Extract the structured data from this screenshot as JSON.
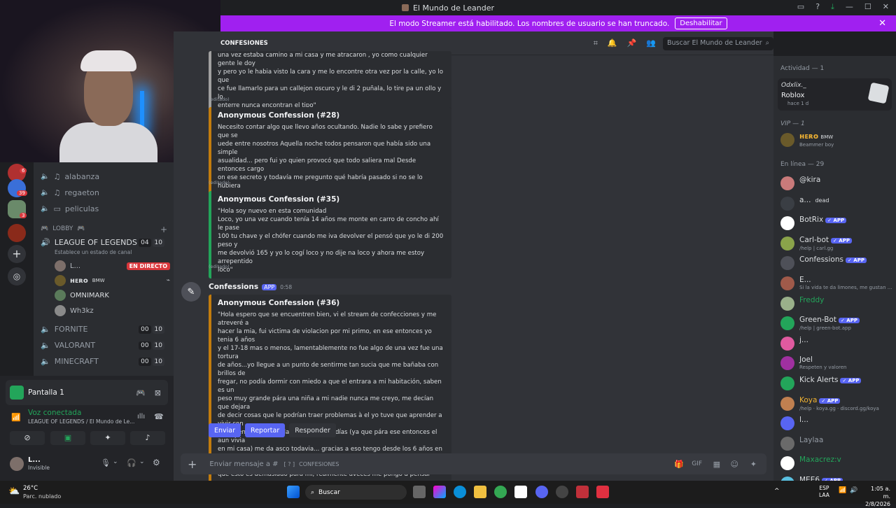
{
  "window": {
    "title": "El Mundo de Leander"
  },
  "streamer_banner": {
    "text": "El modo Streamer está habilitado. Los nombres de usuario se han truncado.",
    "button": "Deshabilitar"
  },
  "channel_header": {
    "name": "CONFESIONES",
    "search_placeholder": "Buscar El Mundo de Leander"
  },
  "sidebar": {
    "text_channels": [
      "alabanza",
      "regaeton",
      "peliculas"
    ],
    "category": "LOBBY",
    "voice_channels": [
      {
        "name": "LEAGUE OF LEGENDS",
        "status": "Establece un estado de canal",
        "count": "04",
        "limit": "10"
      },
      {
        "name": "FORNITE",
        "count": "00",
        "limit": "10"
      },
      {
        "name": "VALORANT",
        "count": "00",
        "limit": "10"
      },
      {
        "name": "MINECRAFT",
        "count": "00",
        "limit": "10"
      }
    ],
    "voice_users": [
      {
        "name": "L...",
        "tag": "EN DIRECTO"
      },
      {
        "name": "ʜᴇʀᴏ",
        "tag": "BMW"
      },
      {
        "name": "OMNIMARK",
        "tag": ""
      },
      {
        "name": "Wh3kz",
        "tag": ""
      }
    ],
    "guild_badges": [
      "6",
      "39",
      "3"
    ]
  },
  "panel": {
    "stream_title": "Pantalla 1",
    "voice_status": "Voz conectada",
    "voice_location": "LEAGUE OF LEGENDS / El Mundo de Le...",
    "user_name": "L...",
    "user_status": "Invisible"
  },
  "messages": {
    "top_embed_text": "una vez estaba camino a mi casa y me atracaron , yo como cualquier gente le doy\ny pero yo le habia visto la cara y me lo encontre otra vez por la calle, yo lo que\nce fue llamarlo para un callejon oscuro y le di 2 puñala, lo tire pa un ollo y lo\nenterre nunca encontran el tipo\"",
    "edited_label": "(editado)",
    "confessions": [
      {
        "title": "Anonymous Confession (#28)",
        "text": "Necesito contar algo que llevo años ocultando. Nadie lo sabe y prefiero que se\nuede entre nosotros Aquella noche todos pensaron que había sido una simple\nasualidad... pero fui yo quien provocó que todo saliera mal Desde entonces cargo\non ese secreto y todavía me pregunto qué habría pasado si no se lo hubiera\nmetido a la hija del teniente\""
      },
      {
        "title": "Anonymous Confession (#35)",
        "text": "\"Hola soy nuevo en esta comunidad\nLoco, yo una vez cuando tenía 14 años me monte en carro de concho ahí le pase\n100 tu chave y el chófer cuando me iva devolver el pensó que yo le di 200 peso y\nme devolvió 165 y yo lo cogí loco y no dije na loco y ahora me estoy arrepentido\nloco\""
      },
      {
        "title": "Anonymous Confession (#36)",
        "text": "\"Hola espero que se encuentren bien, vi el stream de confecciones y me atreveré a\nhacer la mia, fui victima de violacion por mi primo, en ese entonces yo tenia 6 años\ny el 17-18 mas o menos, lamentablemente no fue algo de una vez fue una tortura\nde años...yo llegue a un punto de sentirme tan sucia que me bañaba con brillos de\nfregar, no podía dormir con miedo a que el entrara a mi habitación, saben es un\npeso muy grande pára una niña a mi nadie nunca me creyo, me decían que dejara\nde decir cosas que le podrían traer problemas à el yo tuve que aprender a vivir con\neso a tener que verle la cara todos los días (ya que pára ese entonces el aun vivia\nen mi casa) me da asco todavia... gracias a eso tengo desde los 6 años en\ndepresión, aun no lo supero, me he intentalo suicidar muchas veces ya que siento\nque esto es demasiado pára mi, realmente aveces me pongo a pensar como\nalguien puede ser tan asqueroso pára hacerle algo a una NIÑA.\""
      }
    ],
    "bot_name": "Confessions",
    "bot_tag": "APP",
    "bot_time": "0:58",
    "buttons": {
      "send": "Enviar",
      "report": "Reportar",
      "reply": "Responder"
    }
  },
  "composer": {
    "placeholder": "Enviar mensaje a #",
    "channel": "CONFESIONES"
  },
  "members": {
    "activity_header": "Actividad — 1",
    "activity": {
      "name": "Odxlix._",
      "game": "Roblox",
      "time": "hace 1 d"
    },
    "vip_header": "VIP — 1",
    "vip": {
      "name": "ʜᴇʀᴏ",
      "tag": "BMW",
      "status": "Beammer boy"
    },
    "online_header": "En línea — 29",
    "online": [
      {
        "name": "@kira",
        "status": "",
        "app": false,
        "color": "#dbdee1"
      },
      {
        "name": "a...",
        "status": "",
        "app": false,
        "color": "#dbdee1",
        "inline": "dead"
      },
      {
        "name": "BotRix",
        "status": "",
        "app": true,
        "color": "#dbdee1"
      },
      {
        "name": "Carl-bot",
        "status": "/help | carl.gg",
        "app": true,
        "color": "#dbdee1"
      },
      {
        "name": "Confessions",
        "status": "",
        "app": true,
        "color": "#dbdee1"
      },
      {
        "name": "E...",
        "status": "Si la vida te da limones, me gustan ...",
        "app": false,
        "color": "#dbdee1"
      },
      {
        "name": "Freddy",
        "status": "",
        "app": false,
        "color": "#23a55a"
      },
      {
        "name": "Green-Bot",
        "status": "/help | green-bot.app",
        "app": true,
        "color": "#dbdee1"
      },
      {
        "name": "j...",
        "status": "",
        "app": false,
        "color": "#dbdee1"
      },
      {
        "name": "Joel",
        "status": "Respeten y valoren",
        "app": false,
        "color": "#dbdee1"
      },
      {
        "name": "Kick Alerts",
        "status": "",
        "app": true,
        "color": "#dbdee1"
      },
      {
        "name": "Koya",
        "status": "/help · koya.gg · discord.gg/koya",
        "app": true,
        "color": "#f0b232"
      },
      {
        "name": "l...",
        "status": "",
        "app": false,
        "color": "#dbdee1"
      },
      {
        "name": "Laylaa",
        "status": "",
        "app": false,
        "color": "#949ba4"
      },
      {
        "name": "Maxacrez:v",
        "status": "",
        "app": false,
        "color": "#23a55a"
      },
      {
        "name": "MEE6",
        "status": "",
        "app": true,
        "color": "#dbdee1"
      }
    ]
  },
  "taskbar": {
    "weather_temp": "26°C",
    "weather_desc": "Parc. nublado",
    "search": "Buscar",
    "lang": "ESP",
    "lang2": "LAA",
    "time": "1:05 a. m.",
    "date": "2/8/2026"
  },
  "colors": {
    "brand": "#5865f2",
    "streamer": "#a020f0",
    "online": "#23a55a"
  }
}
